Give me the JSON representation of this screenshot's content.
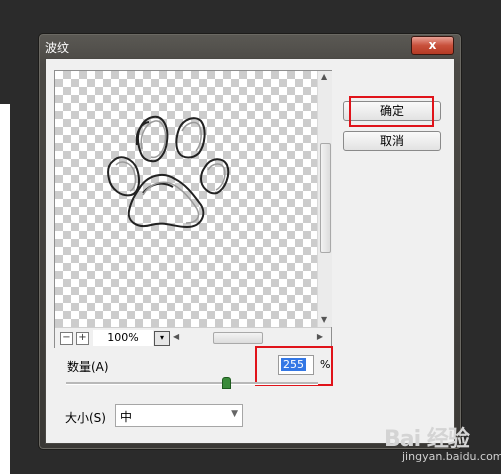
{
  "dialog": {
    "title": "波纹",
    "close_glyph": "x"
  },
  "buttons": {
    "ok_label": "确定",
    "cancel_label": "取消"
  },
  "preview": {
    "zoom_value": "100%",
    "zoom_out_glyph": "−",
    "zoom_in_glyph": "+",
    "dropdown_glyph": "▾"
  },
  "amount": {
    "label": "数量(A)",
    "value": "255",
    "unit": "%",
    "slider_fraction": 0.7
  },
  "size": {
    "label": "大小(S)",
    "selected": "中"
  },
  "watermark": {
    "brand": "Bai 经验",
    "url": "jingyan.baidu.com"
  },
  "colors": {
    "highlight": "#e0131a",
    "selection": "#3377e5",
    "close_button": "#c8503b"
  }
}
